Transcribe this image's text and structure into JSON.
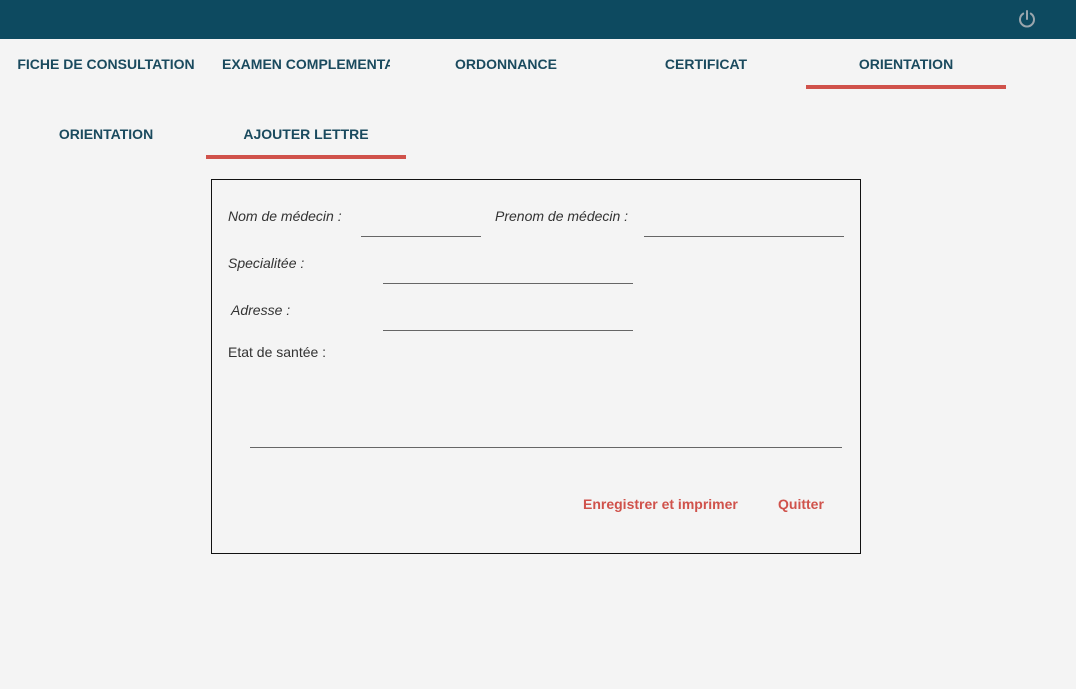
{
  "header": {
    "power_icon": "power-icon",
    "colors": {
      "bar": "#0d4a60",
      "accent": "#d0524b",
      "tab_text": "#1a4a5e"
    }
  },
  "main_tabs": [
    {
      "label": "FICHE DE CONSULTATION",
      "active": false
    },
    {
      "label": "EXAMEN COMPLEMENTAII",
      "active": false
    },
    {
      "label": "ORDONNANCE",
      "active": false
    },
    {
      "label": "CERTIFICAT",
      "active": false
    },
    {
      "label": "ORIENTATION",
      "active": true
    }
  ],
  "sub_tabs": [
    {
      "label": "ORIENTATION",
      "active": false
    },
    {
      "label": "AJOUTER LETTRE",
      "active": true
    }
  ],
  "form": {
    "nom_label": "Nom de médecin :",
    "nom_value": "",
    "prenom_label": "Prenom de médecin :",
    "prenom_value": "",
    "specialite_label": "Specialitée :",
    "specialite_value": "",
    "adresse_label": "Adresse :",
    "adresse_value": "",
    "etat_label": "Etat de santée :",
    "etat_value": "",
    "save_label": "Enregistrer et imprimer",
    "quit_label": "Quitter"
  }
}
